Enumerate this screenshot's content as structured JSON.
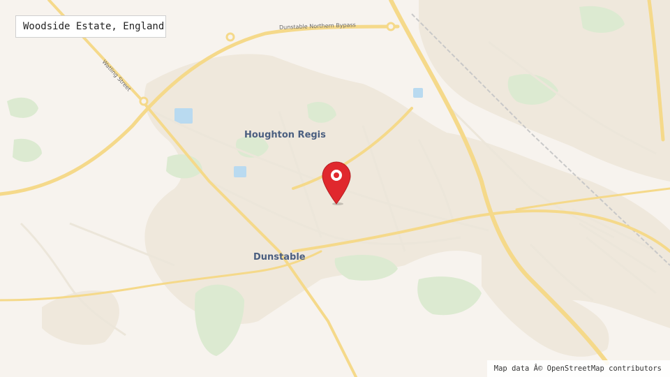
{
  "map": {
    "location_title": "Woodside Estate, England",
    "attribution": "Map data Â© OpenStreetMap contributors",
    "colors": {
      "land": "#f7f3ee",
      "urban": "#efe8dc",
      "green": "#dcead1",
      "water": "#b9daf0",
      "major_road": "#f5d98a",
      "minor_road": "#ece6da",
      "marker": "#e0282d"
    },
    "marker": {
      "icon": "map-pin-icon"
    },
    "labels": {
      "towns": [
        "Houghton Regis",
        "Dunstable"
      ],
      "roads": [
        "Dunstable Northern Bypass",
        "Watling Street"
      ]
    }
  }
}
